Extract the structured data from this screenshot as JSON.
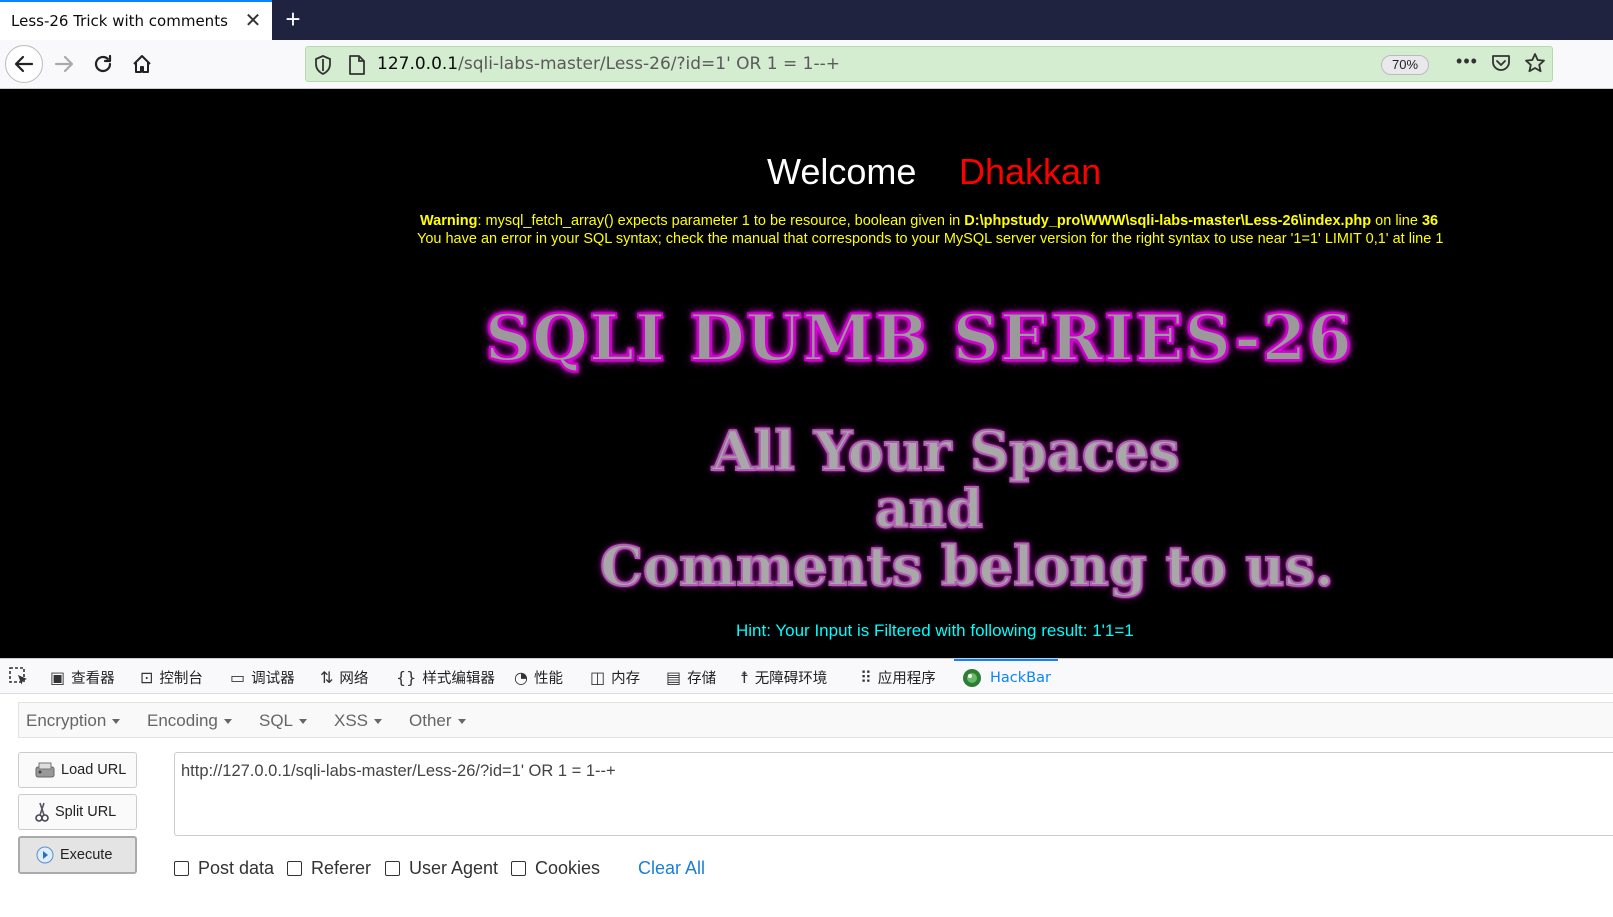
{
  "browser": {
    "tab_title": "Less-26 Trick with comments",
    "url_host": "127.0.0.1",
    "url_path": "/sqli-labs-master/Less-26/?id=1' OR 1 = 1--+",
    "zoom": "70%"
  },
  "page": {
    "welcome": "Welcome",
    "name": "Dhakkan",
    "warning_label": "Warning",
    "warning_msg": ": mysql_fetch_array() expects parameter 1 to be resource, boolean given in ",
    "warning_path": "D:\\phpstudy_pro\\WWW\\sqli-labs-master\\Less-26\\index.php",
    "warning_online": " on line ",
    "warning_line": "36",
    "error_msg": "You have an error in your SQL syntax; check the manual that corresponds to your MySQL server version for the right syntax to use near '1=1' LIMIT 0,1' at line 1",
    "banner_series": "SQLI DUMB SERIES-26",
    "banner_line1": "All Your Spaces",
    "banner_line2": "and",
    "banner_line3": "Comments belong to us.",
    "hint": "Hint: Your Input is Filtered with following result: 1'1=1"
  },
  "devtools": {
    "tabs": [
      "查看器",
      "控制台",
      "调试器",
      "网络",
      "样式编辑器",
      "性能",
      "内存",
      "存储",
      "无障碍环境",
      "应用程序",
      "HackBar"
    ],
    "active_tab": "HackBar"
  },
  "hackbar": {
    "menu": [
      "Encryption",
      "Encoding",
      "SQL",
      "XSS",
      "Other"
    ],
    "load_url": "Load URL",
    "split_url": "Split URL",
    "execute": "Execute",
    "url_value": "http://127.0.0.1/sqli-labs-master/Less-26/?id=1' OR 1 = 1--+",
    "checkboxes": [
      "Post data",
      "Referer",
      "User Agent",
      "Cookies"
    ],
    "clear_all": "Clear All"
  },
  "colors": {
    "accent": "#0a84ff",
    "url_bar_bg": "#d4ecd0",
    "page_bg": "#000000",
    "warning_text": "#ffff00",
    "name_text": "#ff0000",
    "hint_text": "#00ffff",
    "banner_glow": "#ff00ff"
  }
}
